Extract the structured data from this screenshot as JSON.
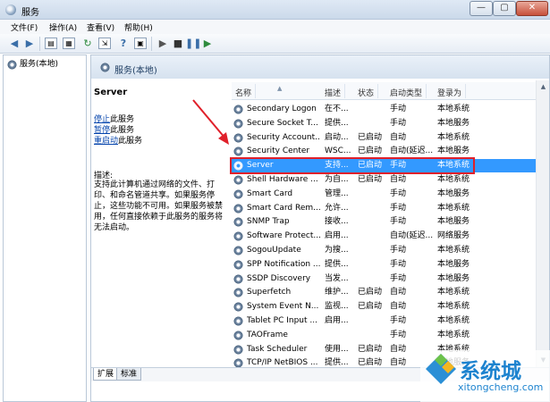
{
  "window": {
    "title": "服务"
  },
  "window_buttons": {
    "minimize": "—",
    "maximize": "▢",
    "close": "✕"
  },
  "menu": [
    "文件(F)",
    "操作(A)",
    "查看(V)",
    "帮助(H)"
  ],
  "tree": {
    "root": "服务(本地)"
  },
  "pane": {
    "header": "服务(本地)"
  },
  "details": {
    "title": "Server",
    "actions": [
      {
        "link": "停止",
        "rest": "此服务"
      },
      {
        "link": "暂停",
        "rest": "此服务"
      },
      {
        "link": "重启动",
        "rest": "此服务"
      }
    ],
    "description_label": "描述:",
    "description_text": "支持此计算机通过网络的文件、打印、和命名管道共享。如果服务停止，这些功能不可用。如果服务被禁用，任何直接依赖于此服务的服务将无法启动。"
  },
  "columns": {
    "name": "名称",
    "desc": "描述",
    "status": "状态",
    "start": "启动类型",
    "logon": "登录为"
  },
  "services": [
    {
      "name": "Secondary Logon",
      "desc": "在不...",
      "status": "",
      "start": "手动",
      "logon": "本地系统",
      "selected": false
    },
    {
      "name": "Secure Socket T...",
      "desc": "提供...",
      "status": "",
      "start": "手动",
      "logon": "本地服务",
      "selected": false
    },
    {
      "name": "Security Account...",
      "desc": "启动...",
      "status": "已启动",
      "start": "自动",
      "logon": "本地系统",
      "selected": false
    },
    {
      "name": "Security Center",
      "desc": "WSC...",
      "status": "已启动",
      "start": "自动(延迟...",
      "logon": "本地服务",
      "selected": false
    },
    {
      "name": "Server",
      "desc": "支持...",
      "status": "已启动",
      "start": "手动",
      "logon": "本地系统",
      "selected": true
    },
    {
      "name": "Shell Hardware ...",
      "desc": "为自...",
      "status": "已启动",
      "start": "自动",
      "logon": "本地系统",
      "selected": false
    },
    {
      "name": "Smart Card",
      "desc": "管理...",
      "status": "",
      "start": "手动",
      "logon": "本地服务",
      "selected": false
    },
    {
      "name": "Smart Card Rem...",
      "desc": "允许...",
      "status": "",
      "start": "手动",
      "logon": "本地系统",
      "selected": false
    },
    {
      "name": "SNMP Trap",
      "desc": "接收...",
      "status": "",
      "start": "手动",
      "logon": "本地服务",
      "selected": false
    },
    {
      "name": "Software Protect...",
      "desc": "启用...",
      "status": "",
      "start": "自动(延迟...",
      "logon": "网络服务",
      "selected": false
    },
    {
      "name": "SogouUpdate",
      "desc": "为搜...",
      "status": "",
      "start": "手动",
      "logon": "本地系统",
      "selected": false
    },
    {
      "name": "SPP Notification ...",
      "desc": "提供...",
      "status": "",
      "start": "手动",
      "logon": "本地服务",
      "selected": false
    },
    {
      "name": "SSDP Discovery",
      "desc": "当发...",
      "status": "",
      "start": "手动",
      "logon": "本地服务",
      "selected": false
    },
    {
      "name": "Superfetch",
      "desc": "维护...",
      "status": "已启动",
      "start": "自动",
      "logon": "本地系统",
      "selected": false
    },
    {
      "name": "System Event N...",
      "desc": "监视...",
      "status": "已启动",
      "start": "自动",
      "logon": "本地系统",
      "selected": false
    },
    {
      "name": "Tablet PC Input ...",
      "desc": "启用...",
      "status": "",
      "start": "手动",
      "logon": "本地系统",
      "selected": false
    },
    {
      "name": "TAOFrame",
      "desc": "",
      "status": "",
      "start": "手动",
      "logon": "本地系统",
      "selected": false
    },
    {
      "name": "Task Scheduler",
      "desc": "使用...",
      "status": "已启动",
      "start": "自动",
      "logon": "本地系统",
      "selected": false
    },
    {
      "name": "TCP/IP NetBIOS ...",
      "desc": "提供...",
      "status": "已启动",
      "start": "自动",
      "logon": "本地服务",
      "selected": false
    }
  ],
  "tabs": [
    "扩展",
    "标准"
  ],
  "watermark": {
    "brand": "系统城",
    "url": "xitongcheng.com"
  },
  "annotation": {
    "color": "#e0202a"
  },
  "colors": {
    "selection": "#3399ff",
    "link": "#0645ad"
  }
}
